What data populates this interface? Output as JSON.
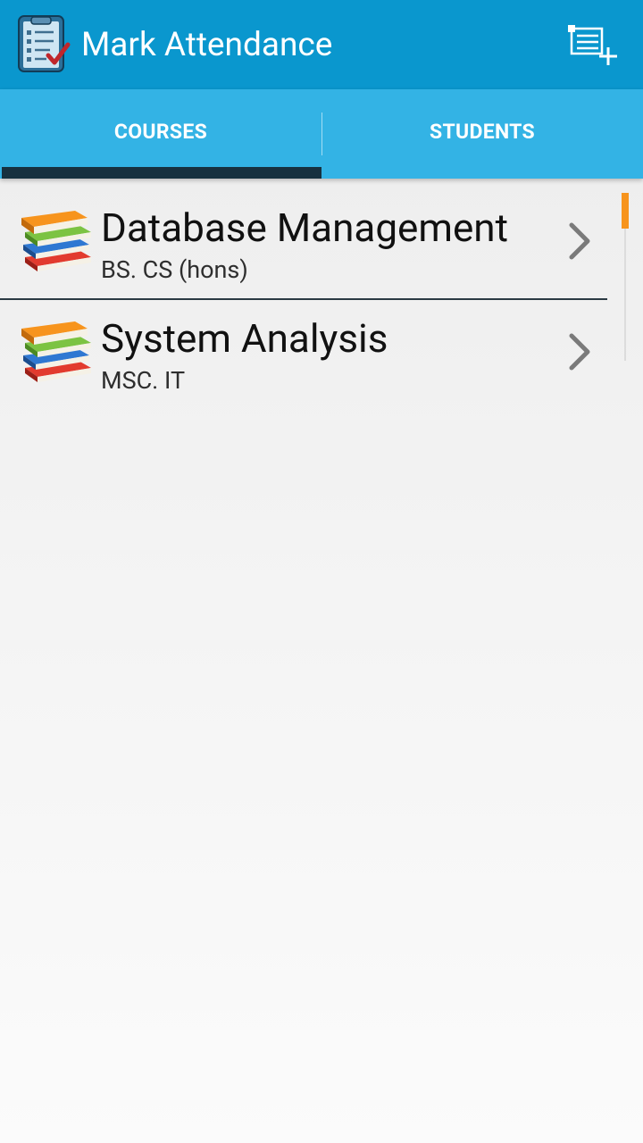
{
  "app": {
    "title": "Mark Attendance",
    "icon": "clipboard-checklist-icon",
    "action_icon": "add-list-icon"
  },
  "tabs": [
    {
      "label": "COURSES",
      "selected": true
    },
    {
      "label": "STUDENTS",
      "selected": false
    }
  ],
  "courses": [
    {
      "name": "Database Management",
      "program": "BS. CS (hons)",
      "icon": "books-stack-icon"
    },
    {
      "name": "System Analysis",
      "program": "MSC. IT",
      "icon": "books-stack-icon"
    }
  ],
  "colors": {
    "action_bar": "#0a97ce",
    "tab_bar": "#33b3e5",
    "tab_indicator": "#17313f",
    "scroll_thumb": "#f7941d"
  }
}
